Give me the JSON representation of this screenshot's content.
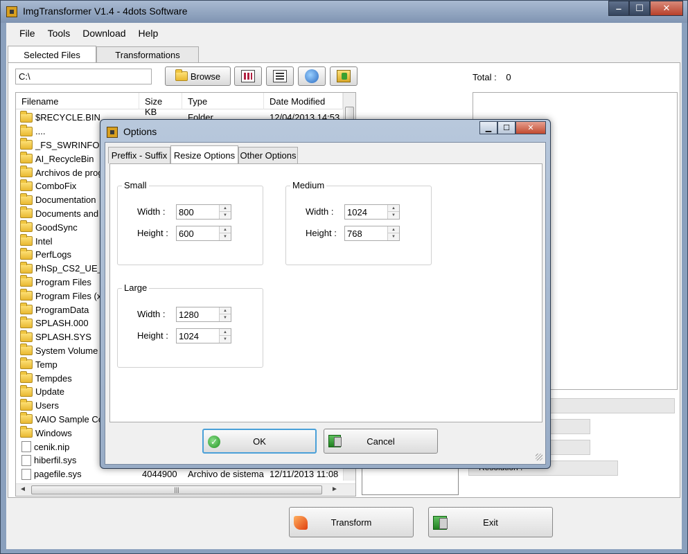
{
  "main_window": {
    "title": "ImgTransformer V1.4 - 4dots Software"
  },
  "menu": [
    "File",
    "Tools",
    "Download",
    "Help"
  ],
  "tabs": [
    "Selected Files",
    "Transformations"
  ],
  "toolbar": {
    "path": "C:\\",
    "browse_label": "Browse"
  },
  "total": {
    "label": "Total :",
    "value": "0"
  },
  "file_list": {
    "columns": [
      "Filename",
      "Size KB",
      "Type",
      "Date Modified"
    ],
    "rows": [
      {
        "name": "$RECYCLE.BIN",
        "size": "",
        "type": "Folder",
        "date": "12/04/2013 14:53",
        "kind": "folder"
      },
      {
        "name": "....",
        "size": "",
        "type": "Folder",
        "date": "",
        "kind": "folder"
      },
      {
        "name": "_FS_SWRINFO",
        "size": "",
        "type": "",
        "date": "",
        "kind": "folder"
      },
      {
        "name": "AI_RecycleBin",
        "size": "",
        "type": "",
        "date": "",
        "kind": "folder"
      },
      {
        "name": "Archivos de progr",
        "size": "",
        "type": "",
        "date": "",
        "kind": "folder"
      },
      {
        "name": "ComboFix",
        "size": "",
        "type": "",
        "date": "",
        "kind": "folder"
      },
      {
        "name": "Documentation",
        "size": "",
        "type": "",
        "date": "",
        "kind": "folder"
      },
      {
        "name": "Documents and S",
        "size": "",
        "type": "",
        "date": "",
        "kind": "folder"
      },
      {
        "name": "GoodSync",
        "size": "",
        "type": "",
        "date": "",
        "kind": "folder"
      },
      {
        "name": "Intel",
        "size": "",
        "type": "",
        "date": "",
        "kind": "folder"
      },
      {
        "name": "PerfLogs",
        "size": "",
        "type": "",
        "date": "",
        "kind": "folder"
      },
      {
        "name": "PhSp_CS2_UE_F",
        "size": "",
        "type": "",
        "date": "",
        "kind": "folder"
      },
      {
        "name": "Program Files",
        "size": "",
        "type": "",
        "date": "",
        "kind": "folder"
      },
      {
        "name": "Program Files (x8",
        "size": "",
        "type": "",
        "date": "",
        "kind": "folder"
      },
      {
        "name": "ProgramData",
        "size": "",
        "type": "",
        "date": "",
        "kind": "folder"
      },
      {
        "name": "SPLASH.000",
        "size": "",
        "type": "",
        "date": "",
        "kind": "folder"
      },
      {
        "name": "SPLASH.SYS",
        "size": "",
        "type": "",
        "date": "",
        "kind": "folder"
      },
      {
        "name": "System Volume In",
        "size": "",
        "type": "",
        "date": "",
        "kind": "folder"
      },
      {
        "name": "Temp",
        "size": "",
        "type": "",
        "date": "",
        "kind": "folder"
      },
      {
        "name": "Tempdes",
        "size": "",
        "type": "",
        "date": "",
        "kind": "folder"
      },
      {
        "name": "Update",
        "size": "",
        "type": "",
        "date": "",
        "kind": "folder"
      },
      {
        "name": "Users",
        "size": "",
        "type": "",
        "date": "",
        "kind": "folder"
      },
      {
        "name": "VAIO Sample Cor",
        "size": "",
        "type": "",
        "date": "",
        "kind": "folder"
      },
      {
        "name": "Windows",
        "size": "",
        "type": "",
        "date": "",
        "kind": "folder"
      },
      {
        "name": "cenik.nip",
        "size": "",
        "type": "",
        "date": "",
        "kind": "file"
      },
      {
        "name": "hiberfil.sys",
        "size": "",
        "type": "",
        "date": "",
        "kind": "file"
      },
      {
        "name": "pagefile.sys",
        "size": "4044900",
        "type": "Archivo de sistema",
        "date": "12/11/2013 11:08",
        "kind": "file"
      }
    ]
  },
  "side_label": "Resolution :",
  "buttons": {
    "transform": "Transform",
    "exit": "Exit"
  },
  "options_dialog": {
    "title": "Options",
    "tabs": [
      "Preffix - Suffix",
      "Resize Options",
      "Other Options"
    ],
    "groups": {
      "small": {
        "label": "Small",
        "width_label": "Width :",
        "width": "800",
        "height_label": "Height :",
        "height": "600"
      },
      "medium": {
        "label": "Medium",
        "width_label": "Width :",
        "width": "1024",
        "height_label": "Height :",
        "height": "768"
      },
      "large": {
        "label": "Large",
        "width_label": "Width :",
        "width": "1280",
        "height_label": "Height :",
        "height": "1024"
      }
    },
    "ok_label": "OK",
    "cancel_label": "Cancel"
  }
}
